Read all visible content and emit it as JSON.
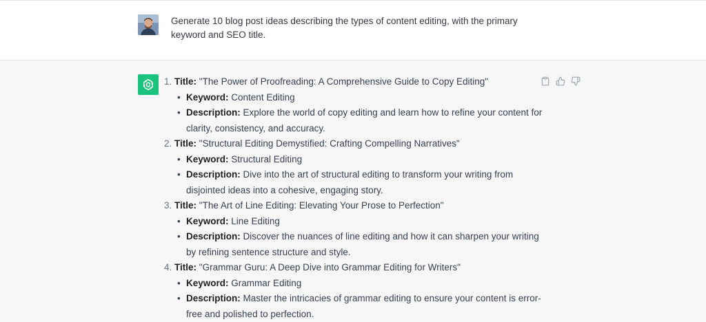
{
  "user_message": {
    "text": "Generate 10 blog post ideas describing the types of content editing, with the primary keyword and SEO title."
  },
  "assistant": {
    "title_label": "Title:",
    "keyword_label": "Keyword:",
    "description_label": "Description:",
    "items": [
      {
        "title": "\"The Power of Proofreading: A Comprehensive Guide to Copy Editing\"",
        "keyword": "Content Editing",
        "description": "Explore the world of copy editing and learn how to refine your content for clarity, consistency, and accuracy."
      },
      {
        "title": "\"Structural Editing Demystified: Crafting Compelling Narratives\"",
        "keyword": "Structural Editing",
        "description": "Dive into the art of structural editing to transform your writing from disjointed ideas into a cohesive, engaging story."
      },
      {
        "title": "\"The Art of Line Editing: Elevating Your Prose to Perfection\"",
        "keyword": "Line Editing",
        "description": "Discover the nuances of line editing and how it can sharpen your writing by refining sentence structure and style."
      },
      {
        "title": "\"Grammar Guru: A Deep Dive into Grammar Editing for Writers\"",
        "keyword": "Grammar Editing",
        "description": "Master the intricacies of grammar editing to ensure your content is error-free and polished to perfection."
      }
    ]
  },
  "icons": {
    "copy": "clipboard-icon",
    "thumbs_up": "thumbs-up-icon",
    "thumbs_down": "thumbs-down-icon"
  },
  "colors": {
    "assistant_avatar": "#19c37d",
    "assistant_bg": "#f7f7f8"
  }
}
